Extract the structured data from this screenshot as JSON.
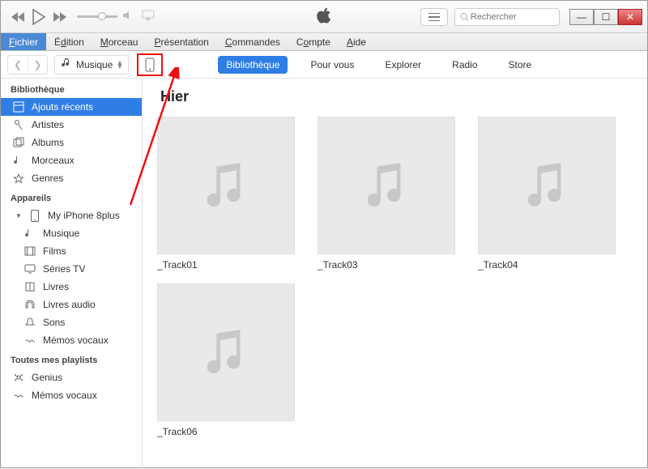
{
  "search_placeholder": "Rechercher",
  "menus": {
    "fichier": "Fichier",
    "edition": "Édition",
    "morceau": "Morceau",
    "presentation": "Présentation",
    "commandes": "Commandes",
    "compte": "Compte",
    "aide": "Aide"
  },
  "category": "Musique",
  "tabs": {
    "bibliotheque": "Bibliothèque",
    "pour_vous": "Pour vous",
    "explorer": "Explorer",
    "radio": "Radio",
    "store": "Store"
  },
  "sidebar": {
    "section_library": "Bibliothèque",
    "library_items": [
      {
        "label": "Ajouts récents",
        "icon": "recent"
      },
      {
        "label": "Artistes",
        "icon": "mic"
      },
      {
        "label": "Albums",
        "icon": "albums"
      },
      {
        "label": "Morceaux",
        "icon": "note"
      },
      {
        "label": "Genres",
        "icon": "genres"
      }
    ],
    "section_devices": "Appareils",
    "device_name": "My iPhone 8plus",
    "device_items": [
      {
        "label": "Musique",
        "icon": "note"
      },
      {
        "label": "Films",
        "icon": "film"
      },
      {
        "label": "Séries TV",
        "icon": "tv"
      },
      {
        "label": "Livres",
        "icon": "book"
      },
      {
        "label": "Livres audio",
        "icon": "audiobook"
      },
      {
        "label": "Sons",
        "icon": "bell"
      },
      {
        "label": "Mémos vocaux",
        "icon": "memo"
      }
    ],
    "section_playlists": "Toutes mes playlists",
    "playlist_items": [
      {
        "label": "Genius",
        "icon": "genius"
      },
      {
        "label": "Mémos vocaux",
        "icon": "memo"
      }
    ]
  },
  "content": {
    "heading": "Hier",
    "tracks": [
      "_Track01",
      "_Track03",
      "_Track04",
      "_Track06"
    ]
  }
}
